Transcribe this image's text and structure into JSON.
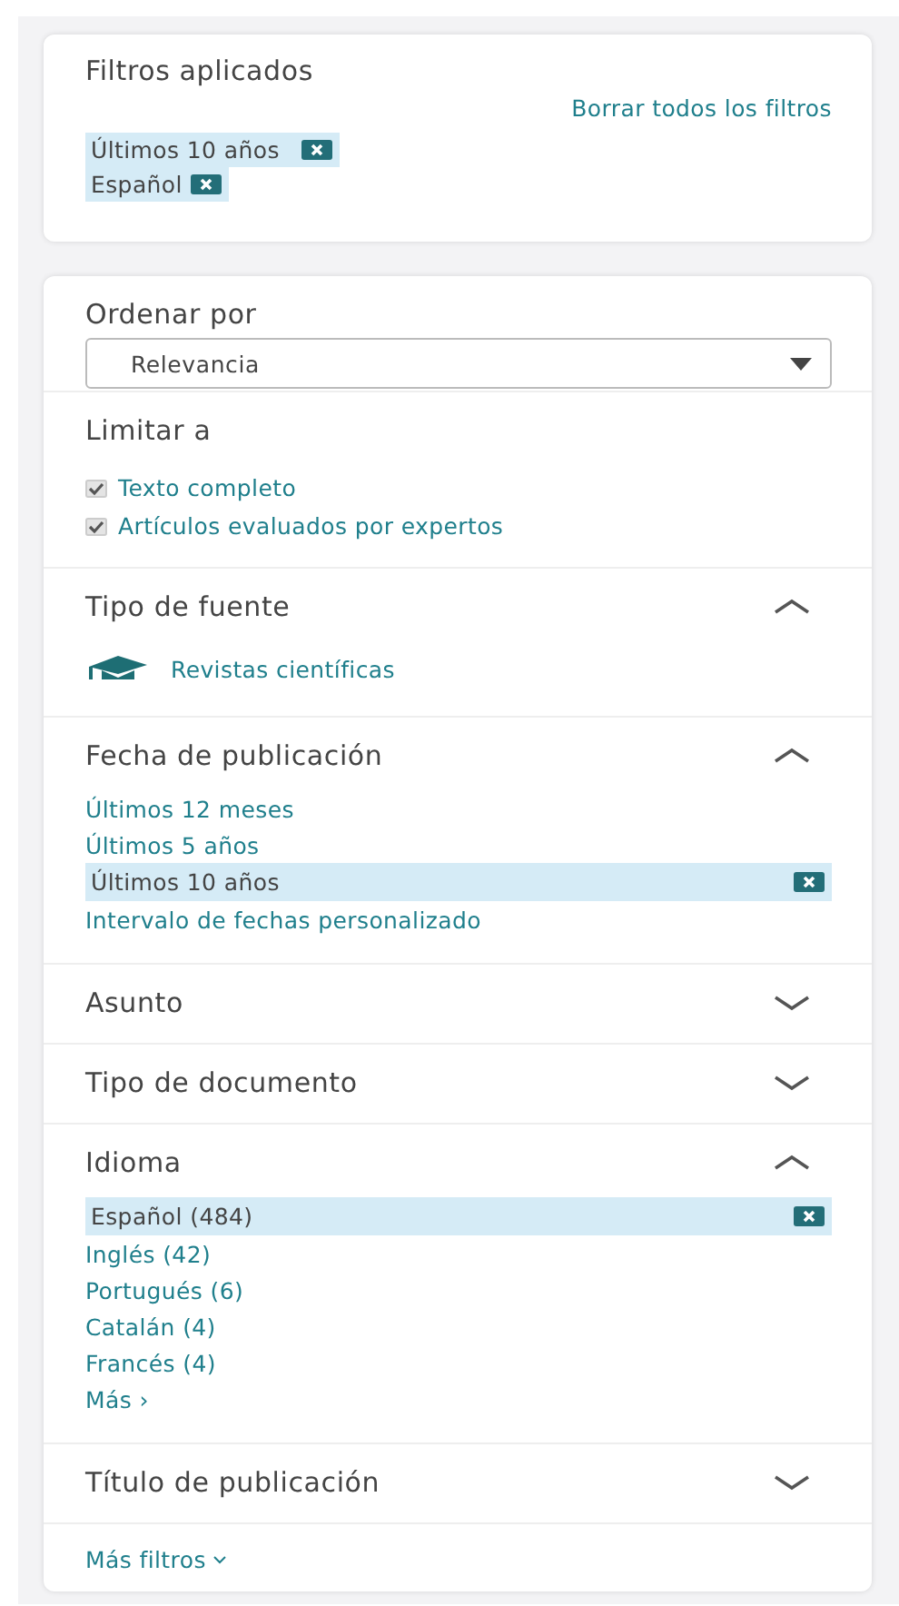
{
  "applied_filters": {
    "title": "Filtros aplicados",
    "clear_link": "Borrar todos los filtros",
    "chips": [
      {
        "label": "Últimos 10 años"
      },
      {
        "label": "Español"
      }
    ]
  },
  "sort": {
    "label": "Ordenar por",
    "value": "Relevancia"
  },
  "limit": {
    "title": "Limitar a",
    "options": [
      {
        "label": "Texto completo",
        "checked": true
      },
      {
        "label": "Artículos evaluados por expertos",
        "checked": true
      }
    ]
  },
  "groups": [
    {
      "title": "Tipo de fuente",
      "expanded": true,
      "items": [
        {
          "kind": "source",
          "label": "Revistas científicas",
          "selected": false
        }
      ]
    },
    {
      "title": "Fecha de publicación",
      "expanded": true,
      "items": [
        {
          "kind": "option",
          "label": "Últimos 12 meses",
          "selected": false
        },
        {
          "kind": "option",
          "label": "Últimos 5 años",
          "selected": false
        },
        {
          "kind": "option",
          "label": "Últimos 10 años",
          "selected": true
        },
        {
          "kind": "option",
          "label": "Intervalo de fechas personalizado",
          "selected": false
        }
      ]
    },
    {
      "title": "Asunto",
      "expanded": false
    },
    {
      "title": "Tipo de documento",
      "expanded": false
    },
    {
      "title": "Idioma",
      "expanded": true,
      "items": [
        {
          "kind": "option",
          "label": "Español (484)",
          "selected": true
        },
        {
          "kind": "option",
          "label": "Inglés (42)",
          "selected": false
        },
        {
          "kind": "option",
          "label": "Portugués (6)",
          "selected": false
        },
        {
          "kind": "option",
          "label": "Catalán (4)",
          "selected": false
        },
        {
          "kind": "option",
          "label": "Francés (4)",
          "selected": false
        },
        {
          "kind": "more",
          "label": "Más ›",
          "selected": false
        }
      ]
    },
    {
      "title": "Título de publicación",
      "expanded": false
    }
  ],
  "more_filters": "Más filtros"
}
